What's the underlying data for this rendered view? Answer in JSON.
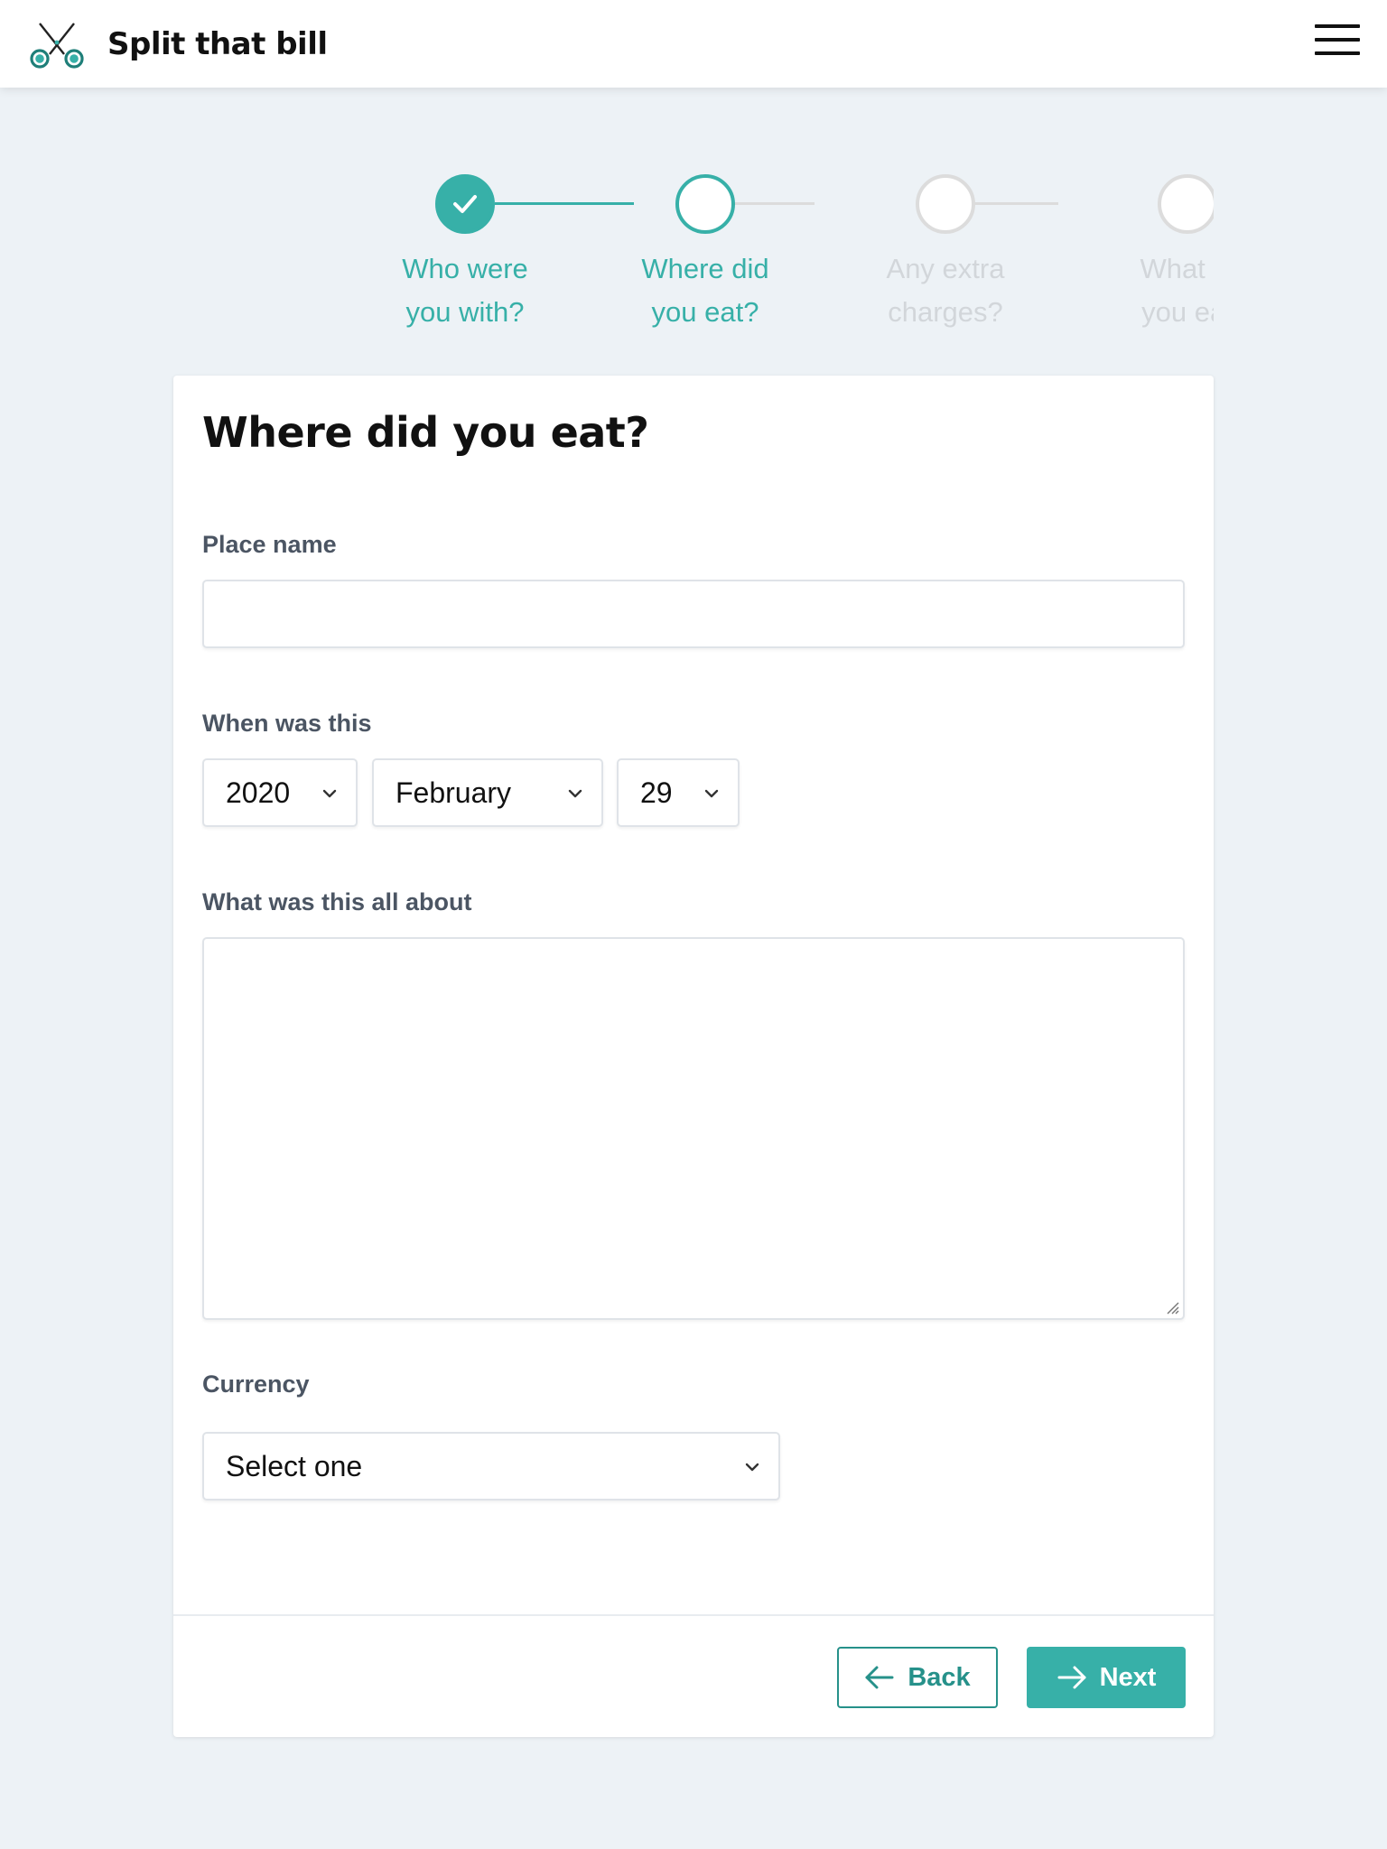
{
  "app": {
    "name": "Split that bill",
    "logo_icon": "scissors-icon",
    "menu_icon": "hamburger-menu-icon"
  },
  "stepper": {
    "steps": [
      {
        "line1": "Who were",
        "line2": "you with?",
        "state": "done"
      },
      {
        "line1": "Where did",
        "line2": "you eat?",
        "state": "current"
      },
      {
        "line1": "Any extra",
        "line2": "charges?",
        "state": "upcoming"
      },
      {
        "line1": "What di",
        "line2": "you eat",
        "state": "upcoming"
      }
    ]
  },
  "form": {
    "title": "Where did you eat?",
    "place": {
      "label": "Place name",
      "value": ""
    },
    "date": {
      "label": "When was this",
      "year": "2020",
      "month": "February",
      "day": "29"
    },
    "about": {
      "label": "What was this all about",
      "value": ""
    },
    "currency": {
      "label": "Currency",
      "value": "Select one"
    }
  },
  "actions": {
    "back": "Back",
    "next": "Next"
  },
  "colors": {
    "accent": "#37b0a8",
    "accent_dark": "#26918a",
    "background": "#edf2f6",
    "inactive": "#d2d6da"
  }
}
